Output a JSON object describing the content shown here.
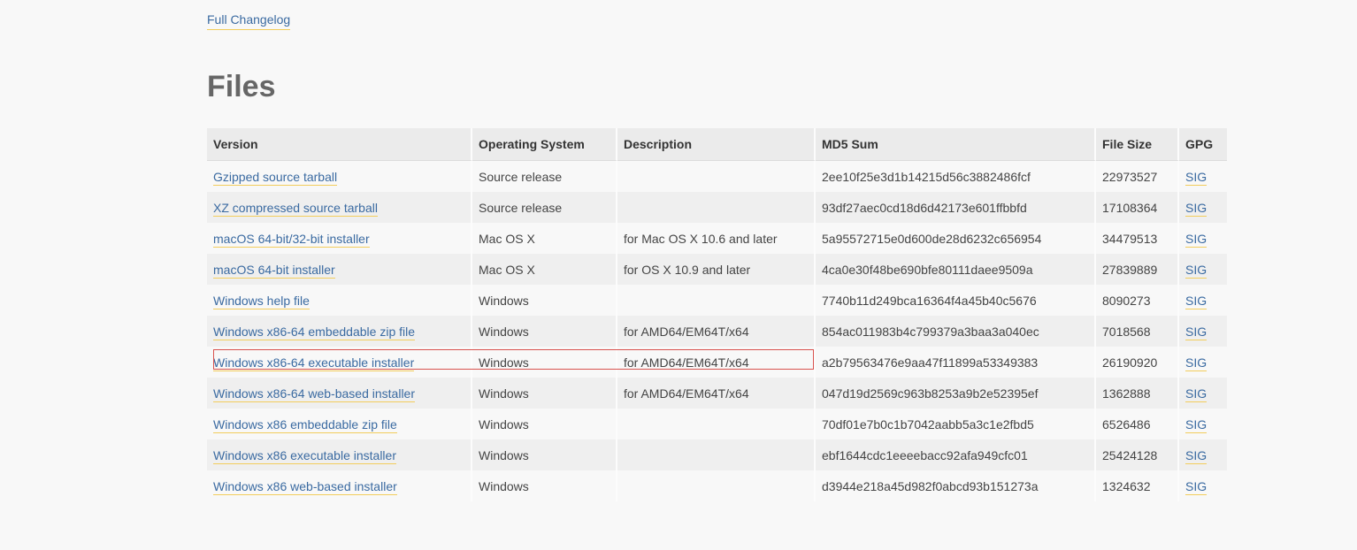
{
  "changelog_link": "Full Changelog",
  "section_title": "Files",
  "columns": {
    "version": "Version",
    "os": "Operating System",
    "description": "Description",
    "md5": "MD5 Sum",
    "size": "File Size",
    "gpg": "GPG"
  },
  "rows": [
    {
      "version": "Gzipped source tarball",
      "os": "Source release",
      "description": "",
      "md5": "2ee10f25e3d1b14215d56c3882486fcf",
      "size": "22973527",
      "gpg": "SIG"
    },
    {
      "version": "XZ compressed source tarball",
      "os": "Source release",
      "description": "",
      "md5": "93df27aec0cd18d6d42173e601ffbbfd",
      "size": "17108364",
      "gpg": "SIG"
    },
    {
      "version": "macOS 64-bit/32-bit installer",
      "os": "Mac OS X",
      "description": "for Mac OS X 10.6 and later",
      "md5": "5a95572715e0d600de28d6232c656954",
      "size": "34479513",
      "gpg": "SIG"
    },
    {
      "version": "macOS 64-bit installer",
      "os": "Mac OS X",
      "description": "for OS X 10.9 and later",
      "md5": "4ca0e30f48be690bfe80111daee9509a",
      "size": "27839889",
      "gpg": "SIG"
    },
    {
      "version": "Windows help file",
      "os": "Windows",
      "description": "",
      "md5": "7740b11d249bca16364f4a45b40c5676",
      "size": "8090273",
      "gpg": "SIG"
    },
    {
      "version": "Windows x86-64 embeddable zip file",
      "os": "Windows",
      "description": "for AMD64/EM64T/x64",
      "md5": "854ac011983b4c799379a3baa3a040ec",
      "size": "7018568",
      "gpg": "SIG"
    },
    {
      "version": "Windows x86-64 executable installer",
      "os": "Windows",
      "description": "for AMD64/EM64T/x64",
      "md5": "a2b79563476e9aa47f11899a53349383",
      "size": "26190920",
      "gpg": "SIG"
    },
    {
      "version": "Windows x86-64 web-based installer",
      "os": "Windows",
      "description": "for AMD64/EM64T/x64",
      "md5": "047d19d2569c963b8253a9b2e52395ef",
      "size": "1362888",
      "gpg": "SIG"
    },
    {
      "version": "Windows x86 embeddable zip file",
      "os": "Windows",
      "description": "",
      "md5": "70df01e7b0c1b7042aabb5a3c1e2fbd5",
      "size": "6526486",
      "gpg": "SIG"
    },
    {
      "version": "Windows x86 executable installer",
      "os": "Windows",
      "description": "",
      "md5": "ebf1644cdc1eeeebacc92afa949cfc01",
      "size": "25424128",
      "gpg": "SIG"
    },
    {
      "version": "Windows x86 web-based installer",
      "os": "Windows",
      "description": "",
      "md5": "d3944e218a45d982f0abcd93b151273a",
      "size": "1324632",
      "gpg": "SIG"
    }
  ],
  "highlight_row": 6
}
